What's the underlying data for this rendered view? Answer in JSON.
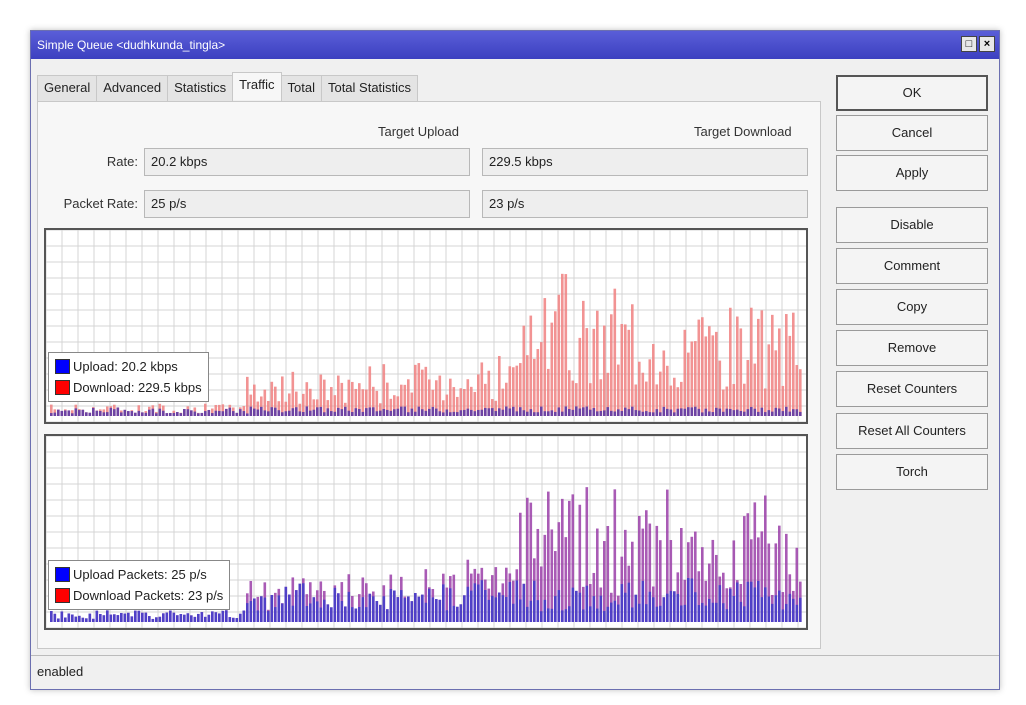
{
  "window": {
    "title": "Simple Queue <dudhkunda_tingla>",
    "min_glyph": "□",
    "close_glyph": "×"
  },
  "tabs": [
    {
      "label": "General"
    },
    {
      "label": "Advanced"
    },
    {
      "label": "Statistics"
    },
    {
      "label": "Traffic",
      "active": true
    },
    {
      "label": "Total"
    },
    {
      "label": "Total Statistics"
    }
  ],
  "traffic": {
    "col_upload": "Target Upload",
    "col_download": "Target Download",
    "rate_label": "Rate:",
    "packet_rate_label": "Packet Rate:",
    "rate_upload": "20.2 kbps",
    "rate_download": "229.5 kbps",
    "packet_upload": "25 p/s",
    "packet_download": "23 p/s"
  },
  "graph1": {
    "legend_upload": "Upload:  20.2 kbps",
    "legend_download": "Download:  229.5 kbps",
    "upload_color": "#0000ff",
    "download_color": "#ff0000"
  },
  "graph2": {
    "legend_upload": "Upload Packets:  25 p/s",
    "legend_download": "Download Packets:  23 p/s",
    "upload_color": "#0000ff",
    "download_color": "#ff0000"
  },
  "buttons": {
    "ok": "OK",
    "cancel": "Cancel",
    "apply": "Apply",
    "disable": "Disable",
    "comment": "Comment",
    "copy": "Copy",
    "remove": "Remove",
    "reset_counters": "Reset Counters",
    "reset_all_counters": "Reset All Counters",
    "torch": "Torch"
  },
  "status": "enabled"
}
